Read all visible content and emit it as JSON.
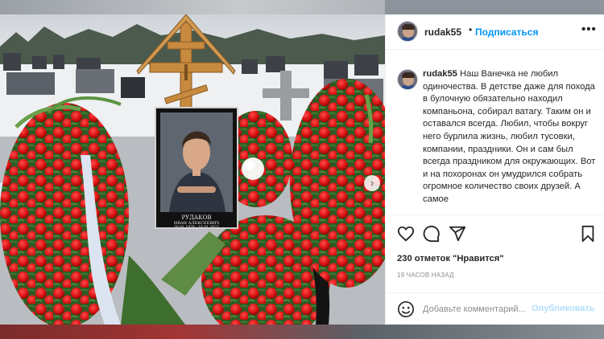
{
  "post": {
    "username": "rudak55",
    "separator": "•",
    "follow_label": "Подписаться",
    "more_icon": "more-options-icon",
    "caption_username": "rudak55",
    "caption_text": "Наш Ванечка не любил одиночества. В детстве даже для похода в булочную обязательно находил компаньона, собирал ватагу. Таким он и оставался всегда. Любил, чтобы вокруг него бурлила жизнь, любил тусовки, компании, праздники. Он и сам был всегда праздником для окружающих. Вот и на похоронах он умудрился собрать огромное количество своих друзей. А самое",
    "likes": "230 отметок \"Нравится\"",
    "time_ago": "19 ЧАСОВ НАЗАД",
    "comment_placeholder": "Добавьте комментарий...",
    "publish_label": "Опубликовать",
    "accent_color": "#0095f6"
  },
  "photo": {
    "portrait_name": "РУДАКОВ",
    "portrait_subname": "ИВАН АЛЕКСЕЕВИЧ",
    "portrait_dates": "20.01.1978 - 16.01.2022",
    "carousel_count": 3,
    "carousel_active": 1
  },
  "icons": [
    "heart-icon",
    "comment-icon",
    "share-icon",
    "bookmark-icon",
    "emoji-icon",
    "chevron-right-icon"
  ]
}
